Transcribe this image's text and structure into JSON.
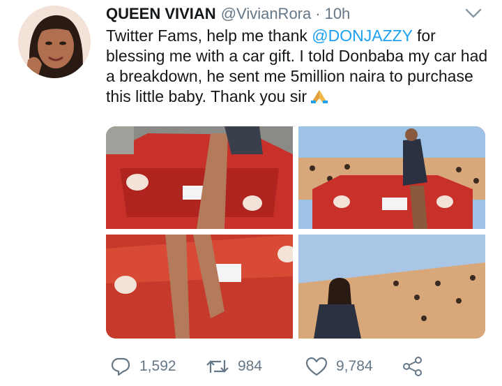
{
  "tweet": {
    "display_name": "QUEEN VIVIAN",
    "handle": "@VivianRora",
    "separator": "·",
    "time": "10h",
    "text_before_mention": "Twitter Fams,  help me thank ",
    "mention": "@DONJAZZY",
    "text_after_mention": " for blessing me with a car gift.  I told Donbaba my car had a breakdown, he sent me 5million naira to purchase this little baby.  Thank you sir",
    "emoji": "folded-hands-icon"
  },
  "media": {
    "count": 4,
    "subjects": [
      "red car rear",
      "woman posing on car",
      "car rear with legs",
      "woman by patterned wall"
    ]
  },
  "actions": {
    "reply_count": "1,592",
    "retweet_count": "984",
    "like_count": "9,784"
  },
  "colors": {
    "text": "#14171a",
    "secondary": "#657786",
    "link": "#1da1f2",
    "car_red": "#c53a2a"
  }
}
